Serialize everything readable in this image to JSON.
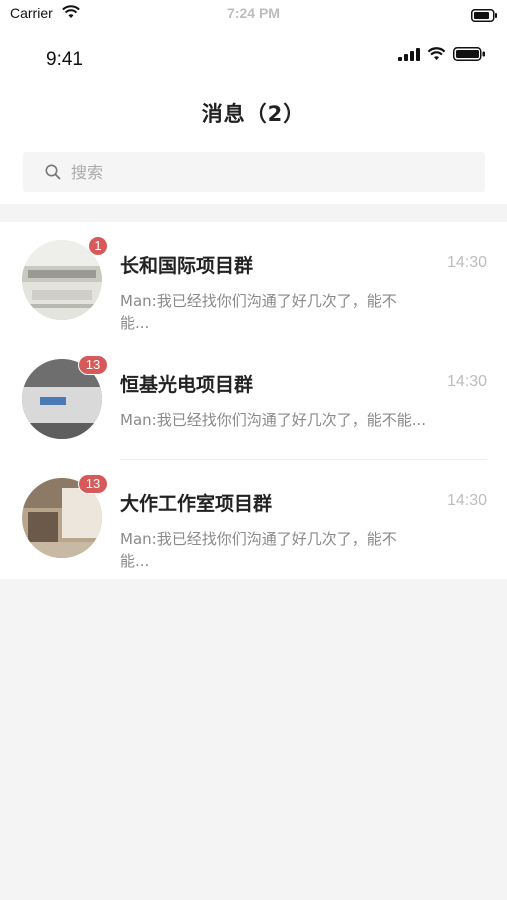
{
  "system_status": {
    "carrier": "Carrier",
    "time": "7:24 PM"
  },
  "app_status": {
    "time": "9:41"
  },
  "header": {
    "title": "消息（2）"
  },
  "search": {
    "placeholder": "搜索"
  },
  "conversations": [
    {
      "name": "长和国际项目群",
      "time": "14:30",
      "badge": "1",
      "preview": "Man:我已经找你们沟通了好几次了，能不能..."
    },
    {
      "name": "恒基光电项目群",
      "time": "14:30",
      "badge": "13",
      "preview": "Man:我已经找你们沟通了好几次了，能不能..."
    },
    {
      "name": "大作工作室项目群",
      "time": "14:30",
      "badge": "13",
      "preview": "Man:我已经找你们沟通了好几次了，能不能..."
    }
  ],
  "colors": {
    "badge": "#d65a5a",
    "background": "#f4f4f4",
    "card": "#ffffff"
  }
}
